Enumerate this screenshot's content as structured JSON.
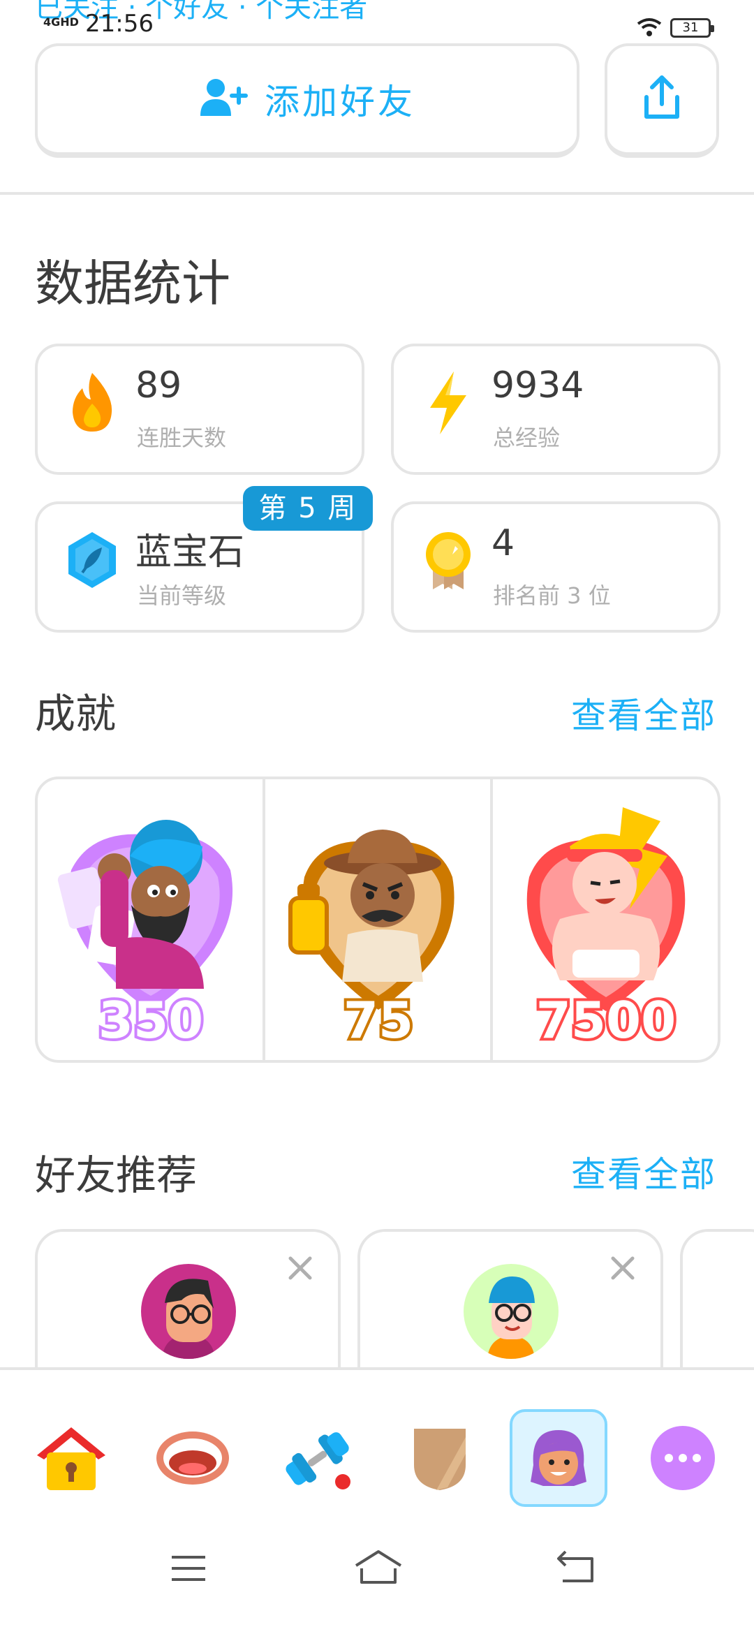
{
  "top_partial_text": "已关注 · 个好友 · 个关注者",
  "status_bar": {
    "network": "4GHD",
    "time": "21:56",
    "battery": "31"
  },
  "add_friend": {
    "label": "添加好友",
    "icon": "add-person-icon"
  },
  "share": {
    "icon": "share-icon"
  },
  "stats": {
    "title": "数据统计",
    "items": [
      {
        "value": "89",
        "label": "连胜天数",
        "icon": "flame-icon",
        "color": "#ff9600"
      },
      {
        "value": "9934",
        "label": "总经验",
        "icon": "lightning-icon",
        "color": "#ffc800"
      },
      {
        "value": "蓝宝石",
        "label": "当前等级",
        "icon": "sapphire-league-icon",
        "color": "#1cb0f6",
        "badge": "第 5 周"
      },
      {
        "value": "4",
        "label": "排名前 3 位",
        "icon": "gold-medal-icon",
        "color": "#ffc800"
      }
    ]
  },
  "achievements": {
    "title": "成就",
    "view_all": "查看全部",
    "items": [
      {
        "value": "350",
        "icon": "wizard-achievement-icon",
        "color": "#ce82ff"
      },
      {
        "value": "75",
        "icon": "explorer-achievement-icon",
        "color": "#cd7900"
      },
      {
        "value": "7500",
        "icon": "champion-achievement-icon",
        "color": "#ff4b4b"
      }
    ]
  },
  "friend_suggestions": {
    "title": "好友推荐",
    "view_all": "查看全部"
  },
  "tabbar": {
    "items": [
      {
        "name": "home",
        "icon": "home-icon"
      },
      {
        "name": "speaking",
        "icon": "mouth-icon"
      },
      {
        "name": "practice",
        "icon": "dumbbell-icon"
      },
      {
        "name": "leagues",
        "icon": "shield-icon"
      },
      {
        "name": "profile",
        "icon": "avatar-icon",
        "active": true
      },
      {
        "name": "more",
        "icon": "more-icon"
      }
    ]
  }
}
